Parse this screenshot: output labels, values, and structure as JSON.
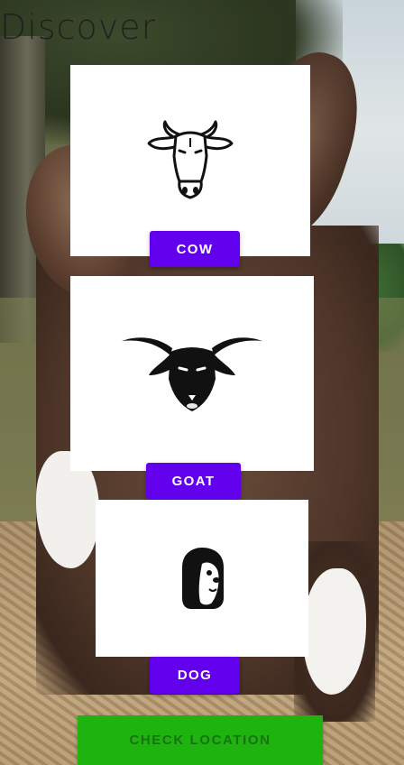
{
  "screen": {
    "title": "Discover"
  },
  "animals": [
    {
      "label": "COW",
      "icon": "cow-icon"
    },
    {
      "label": "GOAT",
      "icon": "goat-icon"
    },
    {
      "label": "DOG",
      "icon": "dog-icon"
    }
  ],
  "actions": {
    "check_location": "CHECK LOCATION"
  },
  "colors": {
    "primary": "#6200ee",
    "check_location": "#1fb30f",
    "card": "#ffffff"
  }
}
